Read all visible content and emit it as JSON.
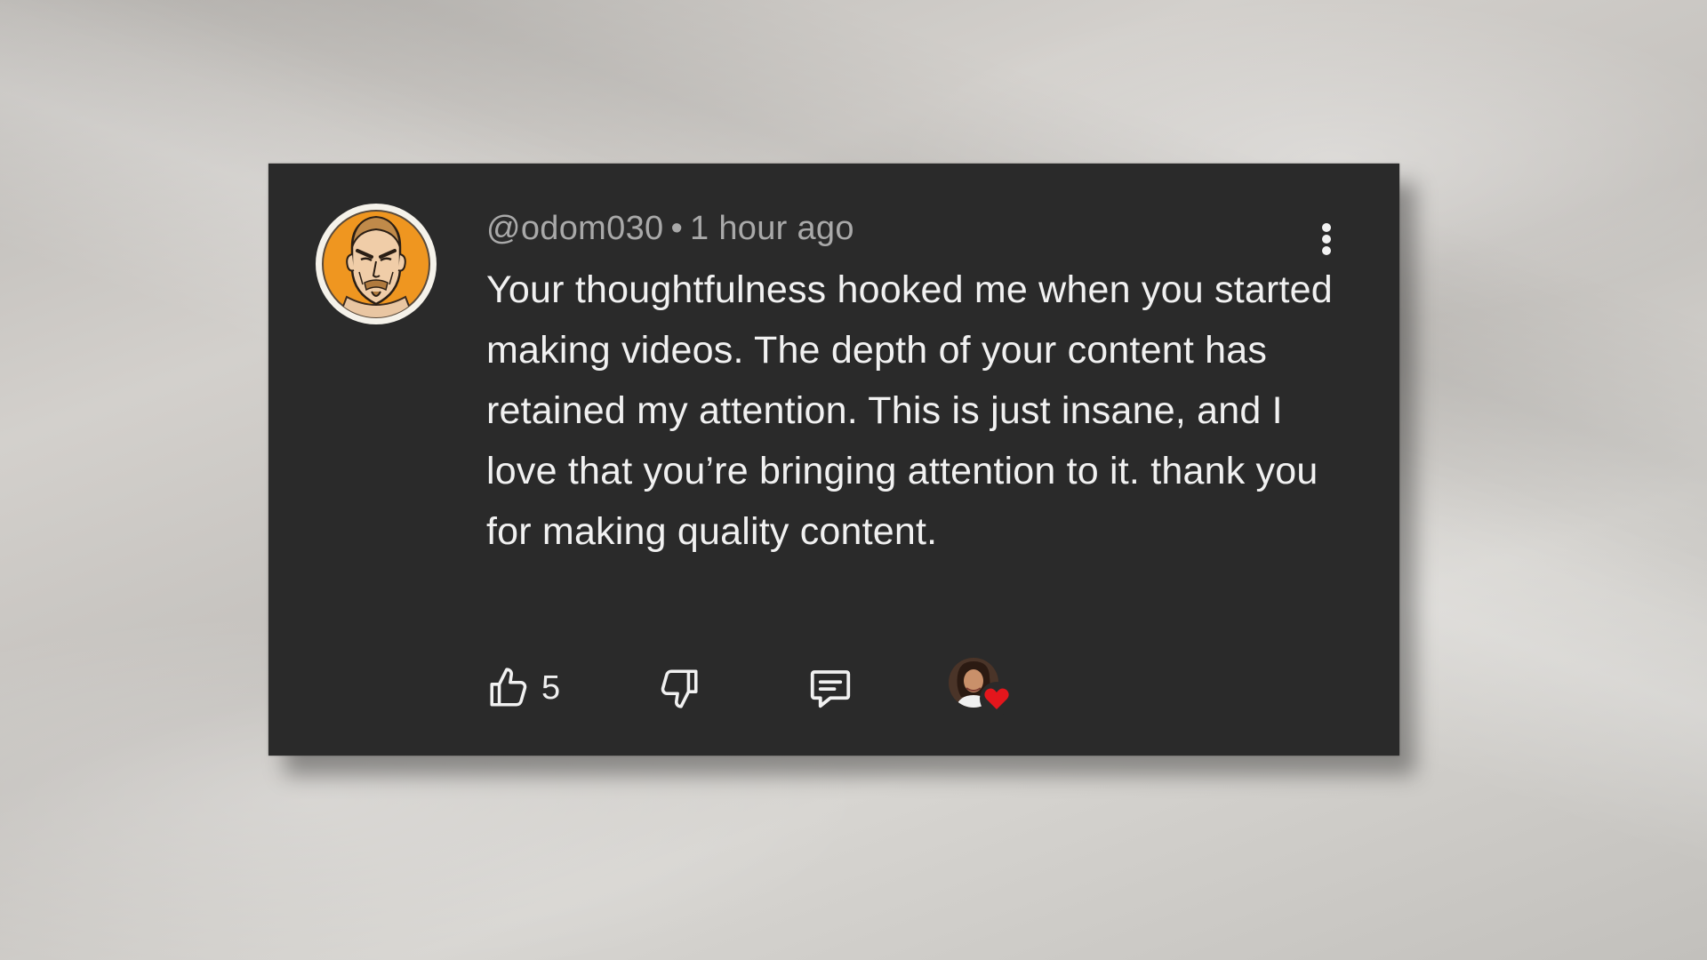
{
  "comment": {
    "username": "@odom030",
    "separator": "•",
    "timestamp": "1 hour ago",
    "text": "Your thoughtfulness hooked me when you started making videos. The depth of your content has retained my attention. This is just insane, and I love that you’re bringing attention to it. thank you for making quality content.",
    "like_count": "5"
  },
  "icons": {
    "avatar": "user-avatar-cartoon",
    "more": "more-vert-icon",
    "like": "thumbs-up-icon",
    "dislike": "thumbs-down-icon",
    "reply": "comment-reply-icon",
    "creator_heart": "creator-heart-icon"
  },
  "colors": {
    "card_background": "#2a2a2a",
    "text_primary": "#f1f1f1",
    "text_secondary": "#a9a9a9",
    "avatar_accent": "#ef9620",
    "heart": "#e4161c"
  }
}
